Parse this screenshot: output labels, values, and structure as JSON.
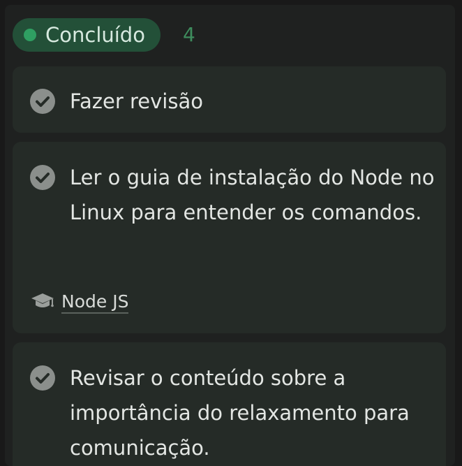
{
  "column": {
    "status": {
      "label": "Concluído",
      "count": "4",
      "dot_color": "#2f9f62",
      "pill_color": "#235038"
    },
    "cards": [
      {
        "title": "Fazer revisão",
        "icon": "check-circle-icon",
        "completed": true
      },
      {
        "title": "Ler o guia de instalação do Node no Linux para entender os comandos.",
        "icon": "check-circle-icon",
        "completed": true,
        "tag": {
          "icon": "graduation-cap-icon",
          "label": "Node JS"
        }
      },
      {
        "title": "Revisar o conteúdo sobre a importância do relaxamento para comunicação.",
        "icon": "check-circle-icon",
        "completed": true
      }
    ]
  }
}
